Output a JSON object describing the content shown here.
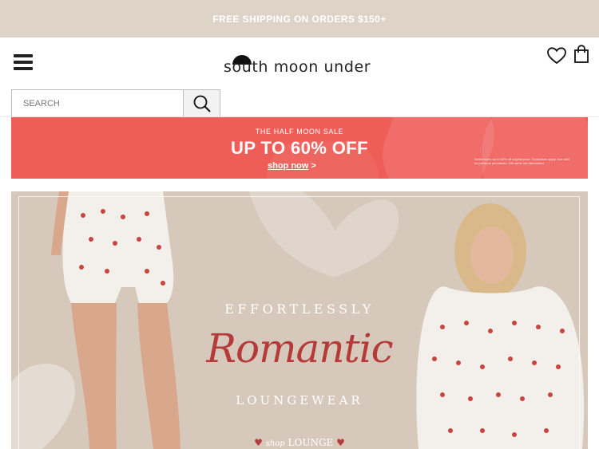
{
  "announcement": {
    "text": "FREE SHIPPING ON ORDERS $150+"
  },
  "header": {
    "logo_text": "south moon under",
    "search_placeholder": "SEARCH"
  },
  "sale_banner": {
    "kicker": "THE HALF MOON SALE",
    "headline": "UP TO 60% OFF",
    "link_label": "shop now",
    "link_arrow": ">",
    "fine_print": "Select sizes up to 60% off original price. Exclusions apply. Not valid on previous purchases. Gift cards not discounted."
  },
  "hero": {
    "line1": "EFFORTLESSLY",
    "script": "Romantic",
    "line2": "LOUNGEWEAR",
    "cta_shop": "shop",
    "cta_label": "LOUNGE",
    "heart_glyph": "♥"
  },
  "colors": {
    "announce_bg": "#ddd3c7",
    "sale_red": "#ef5d58",
    "hero_bg": "#d6c9bb",
    "script_red": "#b53a3a"
  },
  "icons": [
    "menu-icon",
    "heart-icon",
    "shopping-bag-icon",
    "search-icon"
  ]
}
